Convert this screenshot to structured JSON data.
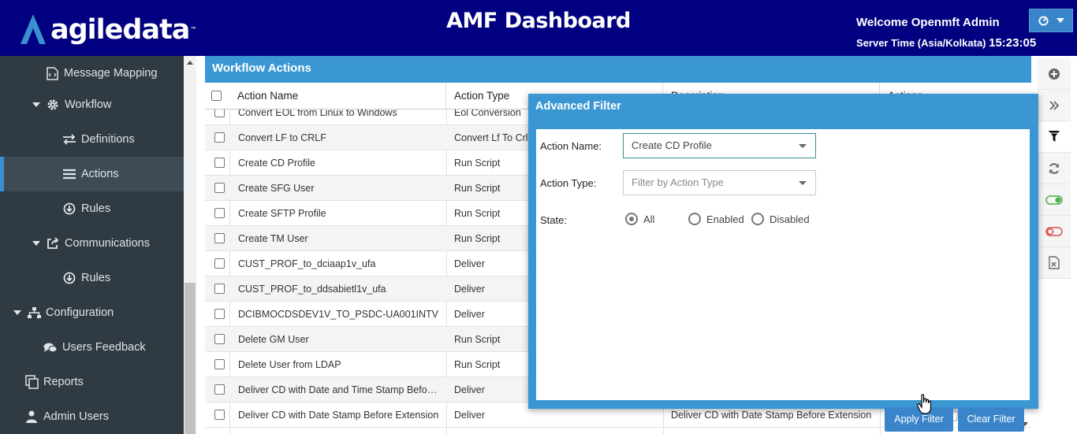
{
  "header": {
    "logo_text": "agiledata",
    "logo_tm": "™",
    "title": "AMF Dashboard",
    "welcome": "Welcome Openmft Admin",
    "server_time_label": "Server Time (Asia/Kolkata)",
    "server_time_value": "15:23:05"
  },
  "sidebar": {
    "items": [
      {
        "label": "Message Mapping",
        "icon": "file-code-icon"
      },
      {
        "label": "Workflow",
        "icon": "gear-icon"
      },
      {
        "label": "Definitions",
        "icon": "exchange-arrows-icon"
      },
      {
        "label": "Actions",
        "icon": "list-icon"
      },
      {
        "label": "Rules",
        "icon": "arrow-circle-down-icon"
      },
      {
        "label": "Communications",
        "icon": "share-icon"
      },
      {
        "label": "Rules",
        "icon": "arrow-circle-down-icon"
      },
      {
        "label": "Configuration",
        "icon": "sitemap-icon"
      },
      {
        "label": "Users Feedback",
        "icon": "comments-icon"
      },
      {
        "label": "Reports",
        "icon": "copy-icon"
      },
      {
        "label": "Admin Users",
        "icon": "user-icon"
      }
    ]
  },
  "panel": {
    "title": "Workflow Actions",
    "columns": [
      "Action Name",
      "Action Type",
      "Description",
      "Actions"
    ]
  },
  "rows": [
    {
      "name": "Convert EOL from Linux to Windows",
      "type": "Eol Conversion",
      "desc": ""
    },
    {
      "name": "Convert LF to CRLF",
      "type": "Convert Lf To Crlf",
      "desc": ""
    },
    {
      "name": "Create CD Profile",
      "type": "Run Script",
      "desc": ""
    },
    {
      "name": "Create SFG User",
      "type": "Run Script",
      "desc": ""
    },
    {
      "name": "Create SFTP Profile",
      "type": "Run Script",
      "desc": ""
    },
    {
      "name": "Create TM User",
      "type": "Run Script",
      "desc": ""
    },
    {
      "name": "CUST_PROF_to_dciaap1v_ufa",
      "type": "Deliver",
      "desc": ""
    },
    {
      "name": "CUST_PROF_to_ddsabietl1v_ufa",
      "type": "Deliver",
      "desc": ""
    },
    {
      "name": "DCIBMOCDSDEV1V_TO_PSDC-UA001INTV",
      "type": "Deliver",
      "desc": ""
    },
    {
      "name": "Delete GM User",
      "type": "Run Script",
      "desc": ""
    },
    {
      "name": "Delete User from LDAP",
      "type": "Run Script",
      "desc": ""
    },
    {
      "name": "Deliver CD with Date and Time Stamp Before ...",
      "type": "Deliver",
      "desc": ""
    },
    {
      "name": "Deliver CD with Date Stamp Before Extension",
      "type": "Deliver",
      "desc": "Deliver CD with Date Stamp Before Extension"
    }
  ],
  "tools": [
    {
      "icon": "plus-circle-icon",
      "color": "#666666"
    },
    {
      "icon": "double-chevron-right-icon",
      "color": "#666666"
    },
    {
      "icon": "filter-icon",
      "color": "#111111"
    },
    {
      "icon": "refresh-icon",
      "color": "#666666"
    },
    {
      "icon": "toggle-on-icon",
      "color": "#4cae4c"
    },
    {
      "icon": "toggle-off-icon",
      "color": "#e05050"
    },
    {
      "icon": "excel-icon",
      "color": "#666666"
    }
  ],
  "filter": {
    "title": "Advanced Filter",
    "action_name_label": "Action Name:",
    "action_name_value": "Create CD Profile",
    "action_type_label": "Action Type:",
    "action_type_placeholder": "Filter by Action Type",
    "state_label": "State:",
    "state_options": [
      "All",
      "Enabled",
      "Disabled"
    ],
    "state_selected": "All",
    "apply_label": "Apply Filter",
    "clear_label": "Clear Filter"
  },
  "colors": {
    "header_bg": "#000080",
    "sidebar_bg": "#2f3a43",
    "accent": "#3b97d3",
    "button": "#3a85c9"
  }
}
